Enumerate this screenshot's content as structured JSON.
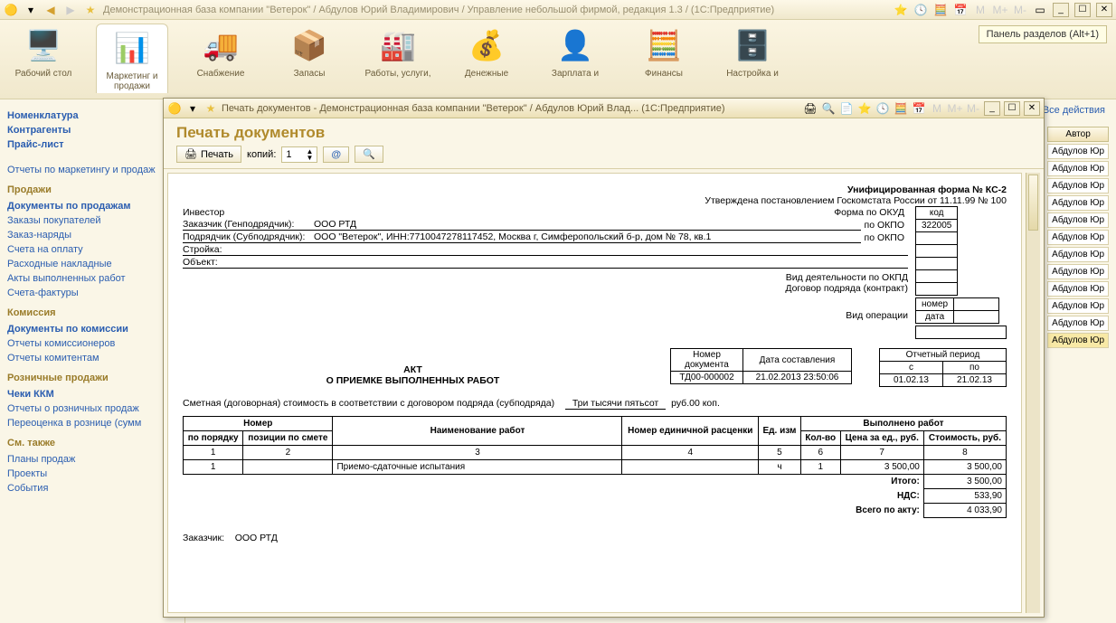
{
  "app_title": "Демонстрационная база компании \"Ветерок\" / Абдулов Юрий Владимирович / Управление небольшой фирмой, редакция 1.3 /  (1С:Предприятие)",
  "sections_hint": "Панель разделов (Alt+1)",
  "sections": [
    {
      "label": "Рабочий стол",
      "icon": "🖥️"
    },
    {
      "label": "Маркетинг и продажи",
      "icon": "📊",
      "active": true
    },
    {
      "label": "Снабжение",
      "icon": "🚚"
    },
    {
      "label": "Запасы",
      "icon": "📦"
    },
    {
      "label": "Работы, услуги,",
      "icon": "🏭"
    },
    {
      "label": "Денежные",
      "icon": "💰"
    },
    {
      "label": "Зарплата и",
      "icon": "👤"
    },
    {
      "label": "Финансы",
      "icon": "🧮"
    },
    {
      "label": "Настройка и",
      "icon": "🗄️"
    }
  ],
  "nav": {
    "g1_items": [
      "Номенклатура",
      "Контрагенты",
      "Прайс-лист"
    ],
    "reports1": "Отчеты по маркетингу и продаж",
    "g2_title": "Продажи",
    "g2_items": [
      "Документы по продажам",
      "Заказы покупателей",
      "Заказ-наряды",
      "Счета на оплату",
      "Расходные накладные",
      "Акты выполненных работ",
      "Счета-фактуры"
    ],
    "g3_title": "Комиссия",
    "g3_items": [
      "Документы по комиссии",
      "Отчеты комиссионеров",
      "Отчеты комитентам"
    ],
    "g4_title": "Розничные продажи",
    "g4_items": [
      "Чеки ККМ",
      "Отчеты о розничных продаж",
      "Переоценка в рознице (сумм"
    ],
    "g5_title": "См. также",
    "g5_items": [
      "Планы продаж",
      "Проекты",
      "События"
    ]
  },
  "right": {
    "all_actions": "Все действия",
    "col_author": "Автор",
    "author_cell": "Абдулов Юр"
  },
  "inner": {
    "title": "Печать документов - Демонстрационная база компании \"Ветерок\" / Абдулов Юрий Влад...   (1С:Предприятие)",
    "header": "Печать документов",
    "btn_print": "Печать",
    "lbl_copies": "копий:",
    "copies_val": "1"
  },
  "doc": {
    "form_title": "Унифицированная форма № КС-2",
    "form_sub": "Утверждена постановлением Госкомстата России от 11.11.99 № 100",
    "kod": "код",
    "okud_lbl": "Форма по ОКУД",
    "okud_val": "322005",
    "okpo_lbl": "по ОКПО",
    "investor_lbl": "Инвестор",
    "customer_lbl": "Заказчик (Генподрядчик):",
    "customer_val": "ООО РТД",
    "contractor_lbl": "Подрядчик (Субподрядчик):",
    "contractor_val": "ООО \"Ветерок\", ИНН:7710047278117452, Москва г, Симферопольский б-р, дом № 78, кв.1",
    "build_lbl": "Стройка:",
    "object_lbl": "Объект:",
    "okpd_lbl": "Вид деятельности по ОКПД",
    "contract_lbl": "Договор подряда (контракт)",
    "num_lbl": "номер",
    "date_lbl": "дата",
    "op_lbl": "Вид операции",
    "docnum_h1": "Номер документа",
    "docnum_h2": "Дата составления",
    "period_h": "Отчетный период",
    "period_from": "с",
    "period_to": "по",
    "docnum": "ТД00-000002",
    "docdate": "21.02.2013 23:50:06",
    "pfrom": "01.02.13",
    "pto": "21.02.13",
    "act1": "АКТ",
    "act2": "О ПРИЕМКЕ ВЫПОЛНЕННЫХ РАБОТ",
    "est_lbl": "Сметная (договорная) стоимость в соответствии с договором подряда (субподряда)",
    "est_val": "Три тысячи пятьсот",
    "est_unit": "руб.00 коп.",
    "th_num": "Номер",
    "th_order": "по порядку",
    "th_est": "позиции по смете",
    "th_name": "Наименование работ",
    "th_price_num": "Номер единичной расценки",
    "th_unit": "Ед. изм",
    "th_done": "Выполнено работ",
    "th_qty": "Кол-во",
    "th_price": "Цена за ед., руб.",
    "th_cost": "Стоимость, руб.",
    "c1": "1",
    "c2": "2",
    "c3": "3",
    "c4": "4",
    "c5": "5",
    "c6": "6",
    "c7": "7",
    "c8": "8",
    "row_name": "Приемо-сдаточные испытания",
    "row_unit": "ч",
    "row_qty": "1",
    "row_price": "3 500,00",
    "row_cost": "3 500,00",
    "tot_itogo": "Итого:",
    "tot_itogo_v": "3 500,00",
    "tot_nds": "НДС:",
    "tot_nds_v": "533,90",
    "tot_all": "Всего по акту:",
    "tot_all_v": "4 033,90",
    "footer_cust": "Заказчик:",
    "footer_cust_v": "ООО РТД"
  }
}
